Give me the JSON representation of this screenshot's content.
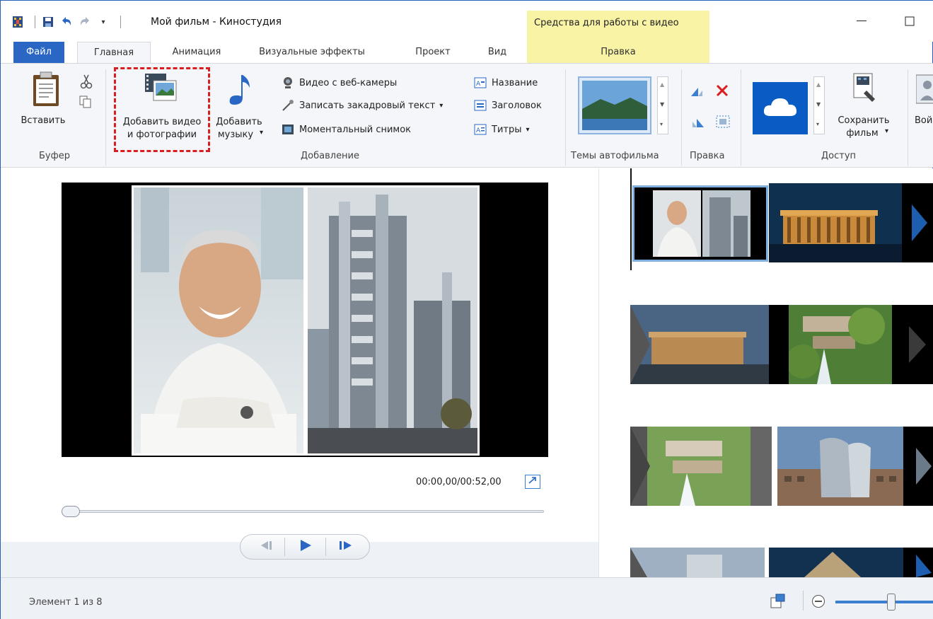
{
  "titlebar": {
    "title": "Мой фильм - Киностудия",
    "context_group": "Средства для работы с видео"
  },
  "tabs": {
    "file": "Файл",
    "home": "Главная",
    "animation": "Анимация",
    "visual_effects": "Визуальные эффекты",
    "project": "Проект",
    "view": "Вид",
    "edit": "Правка"
  },
  "ribbon": {
    "clipboard": {
      "label": "Буфер",
      "paste": "Вставить"
    },
    "add": {
      "label": "Добавление",
      "add_video_photos": [
        "Добавить видео",
        "и фотографии"
      ],
      "add_music": [
        "Добавить",
        "музыку"
      ],
      "webcam": "Видео с веб-камеры",
      "narration": "Записать закадровый текст",
      "snapshot": "Моментальный снимок",
      "title": "Название",
      "caption": "Заголовок",
      "credits": "Титры"
    },
    "themes": {
      "label": "Темы автофильма"
    },
    "editing": {
      "label": "Правка"
    },
    "share": {
      "label": "Доступ",
      "save_movie": [
        "Сохранить",
        "фильм"
      ],
      "signin": "Вой"
    }
  },
  "player": {
    "time": "00:00,00/00:52,00",
    "position": 0.0
  },
  "status": {
    "item": "Элемент 1 из 8"
  },
  "colors": {
    "accent": "#2a67c5",
    "context_tab": "#f9f3a6",
    "highlight_dash": "#d81e1e"
  }
}
